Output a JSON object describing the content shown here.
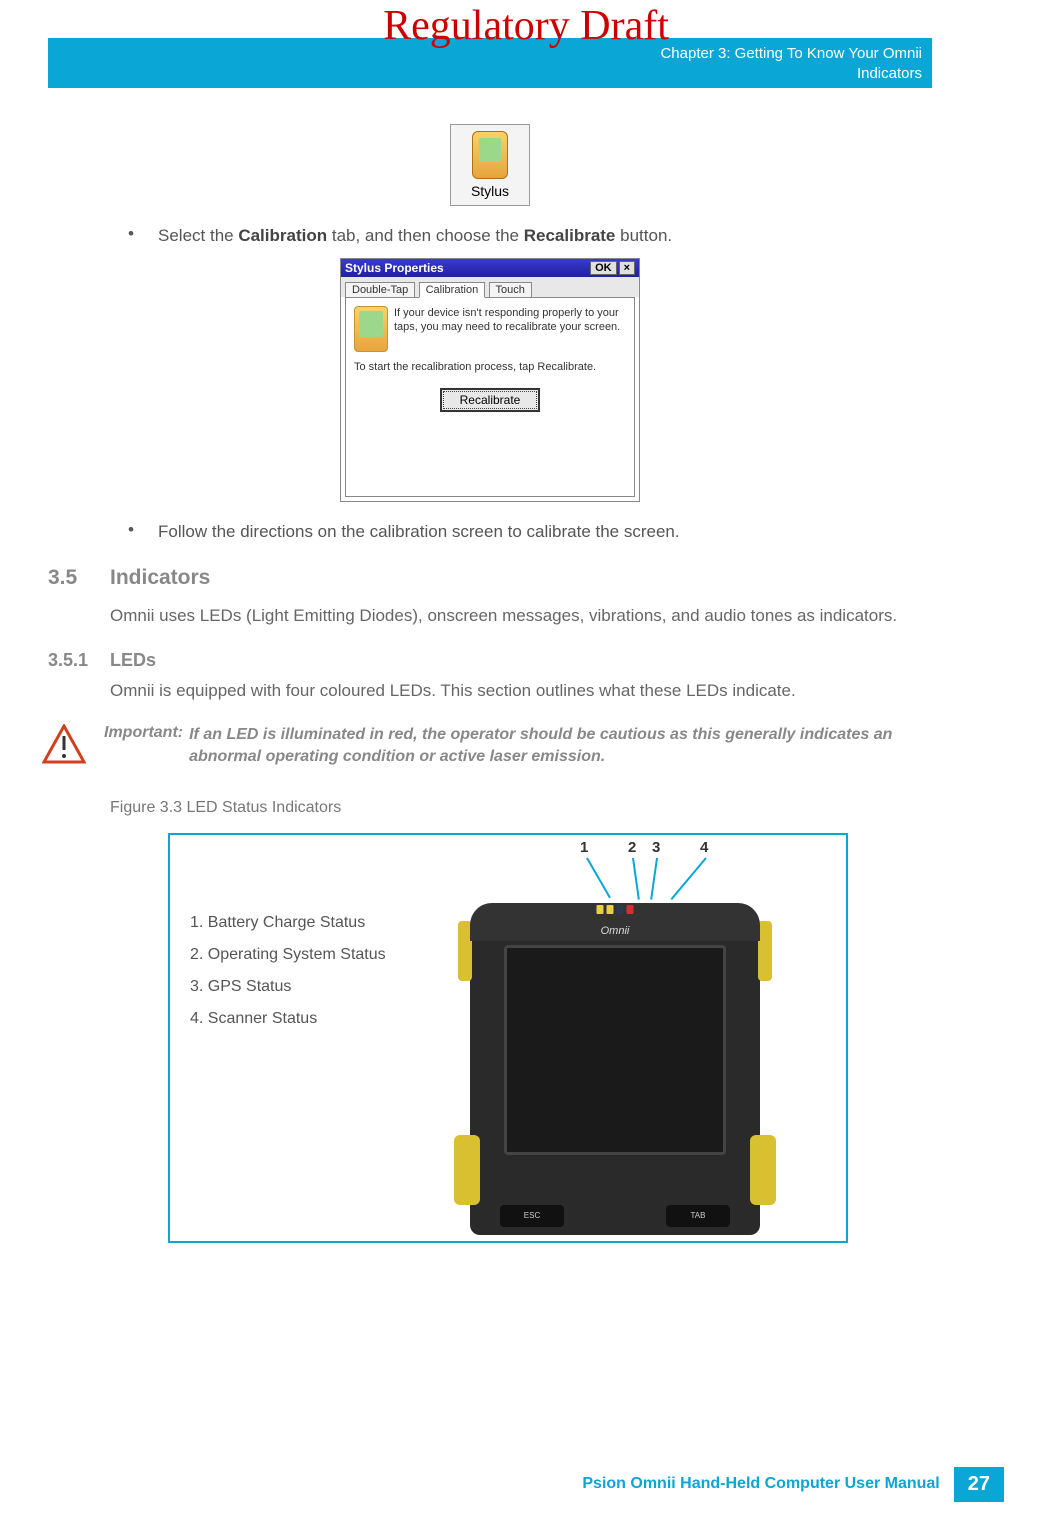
{
  "watermark": "Regulatory Draft",
  "header": {
    "line1": "Chapter 3:  Getting To Know Your Omnii",
    "line2": "Indicators"
  },
  "stylus_icon_label": "Stylus",
  "bullets": {
    "b1_pre": "Select the ",
    "b1_bold1": "Calibration",
    "b1_mid": " tab, and then choose the ",
    "b1_bold2": "Recalibrate",
    "b1_post": " button.",
    "b2": "Follow the directions on the calibration screen to calibrate the screen."
  },
  "dialog": {
    "title": "Stylus Properties",
    "ok": "OK",
    "close": "×",
    "tab1": "Double-Tap",
    "tab2": "Calibration",
    "tab3": "Touch",
    "text1": "If your device isn't responding properly to your taps, you may need to recalibrate your screen.",
    "text2": "To start the recalibration process, tap Recalibrate.",
    "button": "Recalibrate"
  },
  "sections": {
    "s35_num": "3.5",
    "s35_title": "Indicators",
    "s35_body": "Omnii uses LEDs (Light Emitting Diodes), onscreen messages, vibrations, and audio tones as indicators.",
    "s351_num": "3.5.1",
    "s351_title": "LEDs",
    "s351_body": "Omnii is equipped with four coloured LEDs. This section outlines what these LEDs indicate."
  },
  "important": {
    "label": "Important:",
    "text": "If an LED is illuminated in red, the operator should be cautious as this generally indicates an abnormal operating condition or active laser emission."
  },
  "figure_caption": "Figure 3.3    LED Status Indicators",
  "figure_labels": {
    "l1": "1. Battery Charge Status",
    "l2": "2. Operating System Status",
    "l3": "3. GPS Status",
    "l4": "4. Scanner Status"
  },
  "callouts": {
    "n1": "1",
    "n2": "2",
    "n3": "3",
    "n4": "4"
  },
  "device": {
    "brand": "Omnii",
    "key_left": "ESC",
    "key_right": "TAB"
  },
  "footer": {
    "text": "Psion Omnii Hand-Held Computer User Manual",
    "page": "27"
  }
}
